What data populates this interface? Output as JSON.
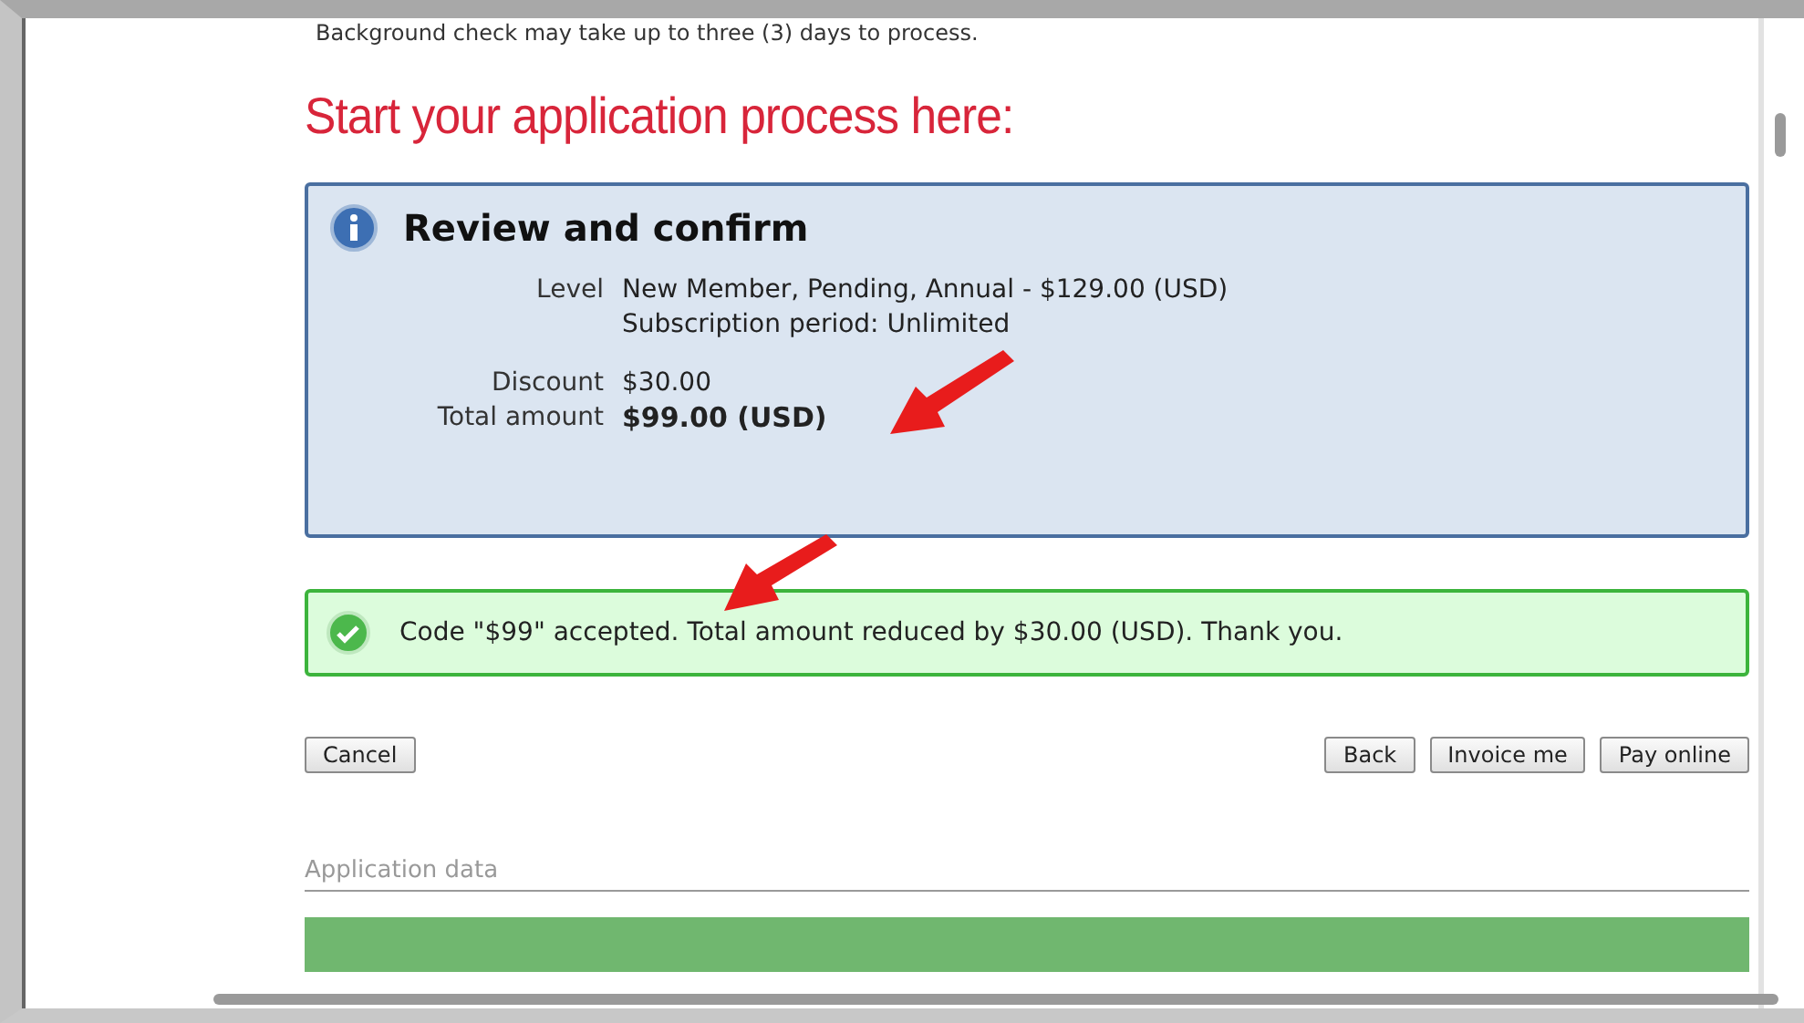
{
  "notice": "Background check may take up to three (3) days to process.",
  "heading": "Start your application process here:",
  "review": {
    "title": "Review and confirm",
    "rows": [
      {
        "label": "Level",
        "lines": [
          "New Member, Pending, Annual - $129.00 (USD)",
          "Subscription period: Unlimited"
        ],
        "bold": false
      },
      {
        "label": "Discount",
        "lines": [
          "$30.00"
        ],
        "bold": false
      },
      {
        "label": "Total amount",
        "lines": [
          "$99.00 (USD)"
        ],
        "bold": true
      }
    ]
  },
  "success": "Code \"$99\" accepted. Total amount reduced by $30.00 (USD). Thank you.",
  "left_buttons": [
    "Cancel"
  ],
  "right_buttons": [
    "Back",
    "Invoice me",
    "Pay online"
  ],
  "section": {
    "title": "Application data"
  }
}
